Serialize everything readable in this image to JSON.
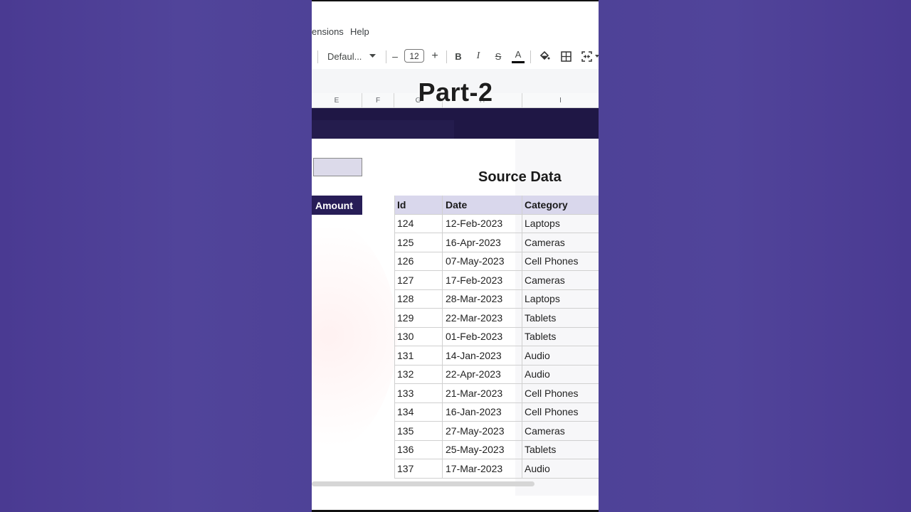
{
  "menu": {
    "extensions": "ensions",
    "help": "Help"
  },
  "toolbar": {
    "font_name": "Defaul...",
    "font_size": "12",
    "decrease_label": "–",
    "increase_label": "+",
    "bold_label": "B",
    "italic_label": "I",
    "strike_label": "S",
    "textcolor_label": "A"
  },
  "overlay_title": "Part-2",
  "columns": [
    "E",
    "F",
    "G",
    "H",
    "I"
  ],
  "input_panel": {
    "amount_header": "Amount"
  },
  "source": {
    "title": "Source Data",
    "headers": [
      "Id",
      "Date",
      "Category"
    ],
    "rows": [
      [
        "124",
        "12-Feb-2023",
        "Laptops"
      ],
      [
        "125",
        "16-Apr-2023",
        "Cameras"
      ],
      [
        "126",
        "07-May-2023",
        "Cell Phones"
      ],
      [
        "127",
        "17-Feb-2023",
        "Cameras"
      ],
      [
        "128",
        "28-Mar-2023",
        "Laptops"
      ],
      [
        "129",
        "22-Mar-2023",
        "Tablets"
      ],
      [
        "130",
        "01-Feb-2023",
        "Tablets"
      ],
      [
        "131",
        "14-Jan-2023",
        "Audio"
      ],
      [
        "132",
        "22-Apr-2023",
        "Audio"
      ],
      [
        "133",
        "21-Mar-2023",
        "Cell Phones"
      ],
      [
        "134",
        "16-Jan-2023",
        "Cell Phones"
      ],
      [
        "135",
        "27-May-2023",
        "Cameras"
      ],
      [
        "136",
        "25-May-2023",
        "Tablets"
      ],
      [
        "137",
        "17-Mar-2023",
        "Audio"
      ]
    ]
  },
  "colors": {
    "background": "#4f4398",
    "header_dark": "#271d57",
    "table_header": "#d9d7ec",
    "input_cell": "#dcdaea"
  },
  "icons": [
    "paint-bucket-icon",
    "borders-icon",
    "merge-cells-icon"
  ]
}
